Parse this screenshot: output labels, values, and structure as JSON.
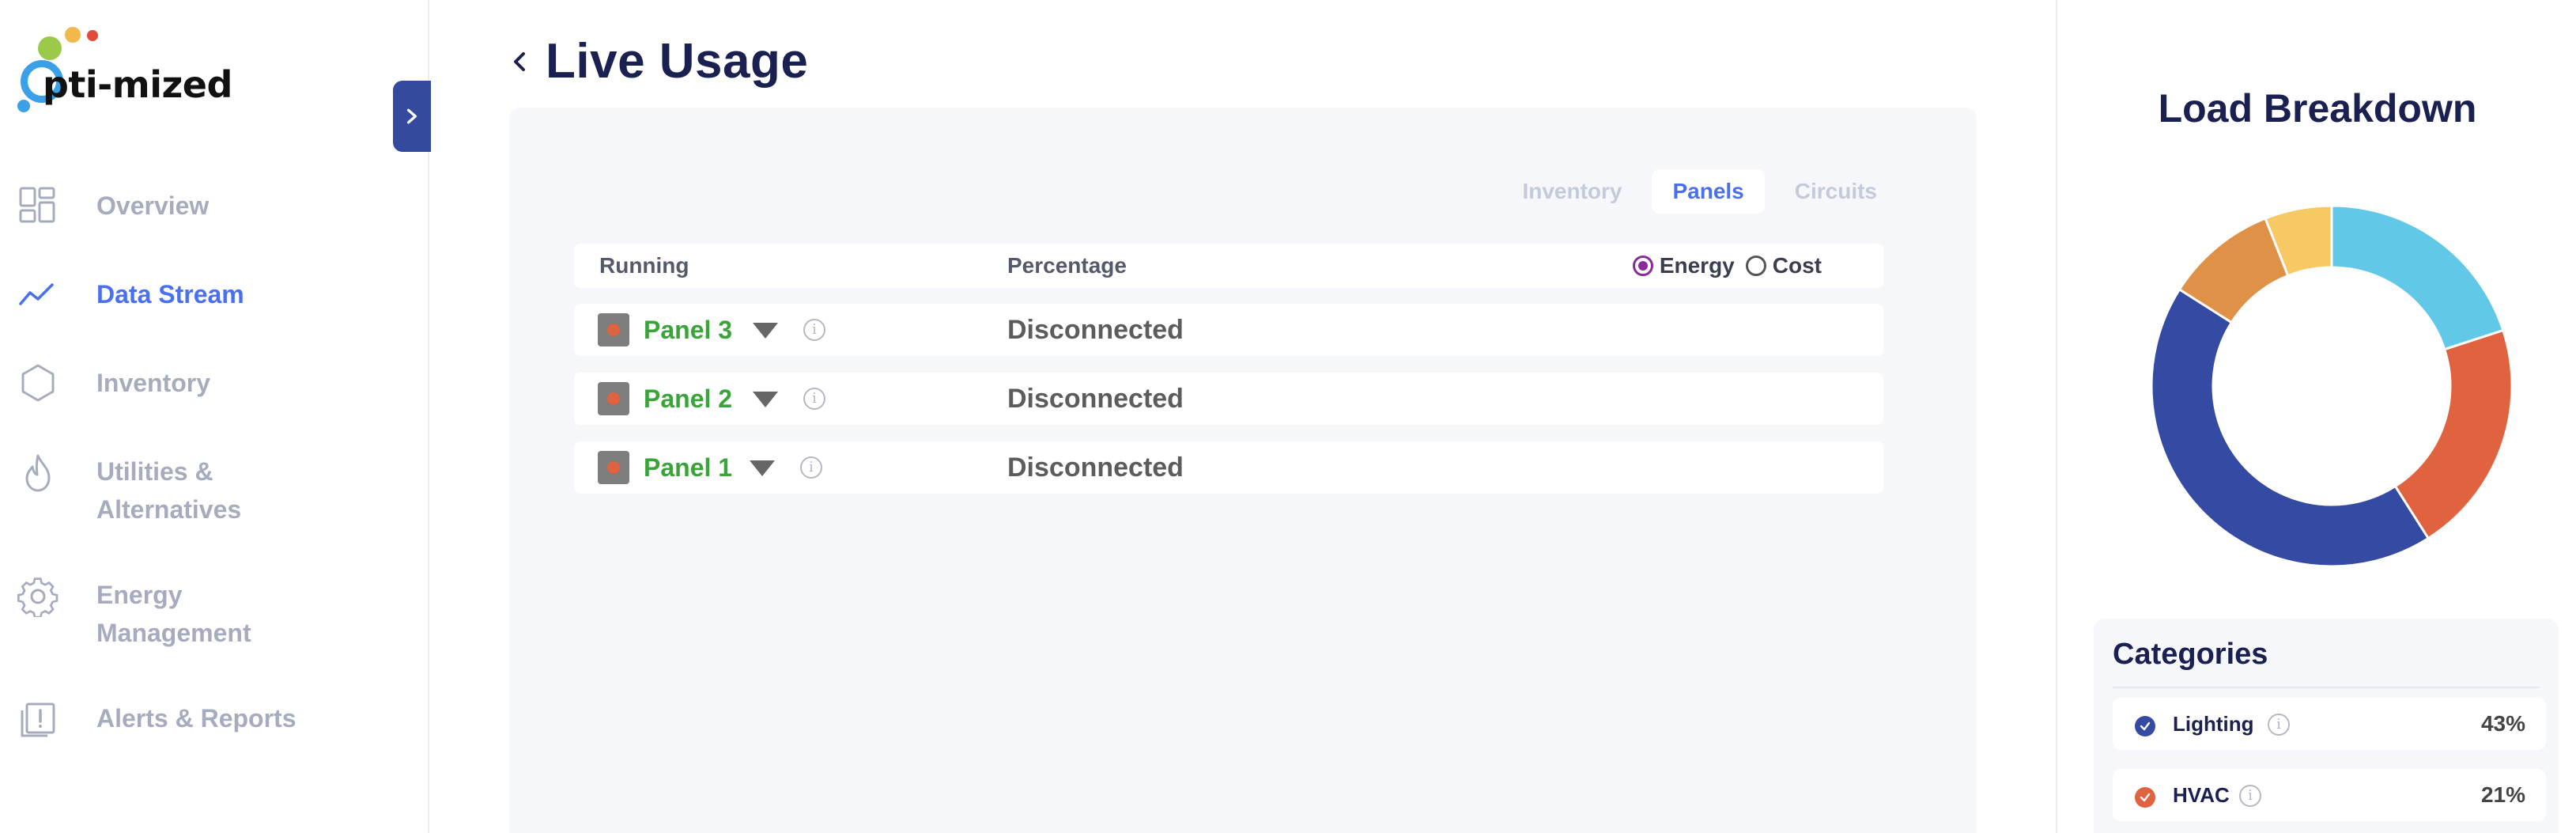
{
  "app": {
    "brand": "Opti-mized",
    "brand_text": "pti-mized",
    "brand_dot_colors": [
      "#9bc94a",
      "#f2b84b",
      "#e04b3a"
    ]
  },
  "sidebar": {
    "items": [
      {
        "label": "Overview",
        "icon": "grid-icon",
        "active": false
      },
      {
        "label": "Data Stream",
        "icon": "trend-line-icon",
        "active": true
      },
      {
        "label": "Inventory",
        "icon": "hexagon-icon",
        "active": false
      },
      {
        "label": "Utilities &",
        "label2": "Alternatives",
        "icon": "flame-icon",
        "active": false
      },
      {
        "label": "Energy",
        "label2": "Management",
        "icon": "gear-icon",
        "active": false
      },
      {
        "label": "Alerts & Reports",
        "icon": "alert-report-icon",
        "active": false
      }
    ]
  },
  "main": {
    "title": "Live Usage",
    "tabs": [
      {
        "label": "Inventory",
        "active": false
      },
      {
        "label": "Panels",
        "active": true
      },
      {
        "label": "Circuits",
        "active": false
      }
    ],
    "table": {
      "col_running": "Running",
      "col_percentage": "Percentage",
      "mode_energy": "Energy",
      "mode_cost": "Cost",
      "mode_selected": "Energy",
      "rows": [
        {
          "name": "Panel 3",
          "status": "Disconnected"
        },
        {
          "name": "Panel 2",
          "status": "Disconnected"
        },
        {
          "name": "Panel 1",
          "status": "Disconnected"
        }
      ]
    }
  },
  "right": {
    "title": "Load Breakdown",
    "categories_title": "Categories",
    "categories": [
      {
        "label": "Lighting",
        "pct": "43%",
        "color": "#354ba3"
      },
      {
        "label": "HVAC",
        "pct": "21%",
        "color": "#e0623f"
      }
    ],
    "donut": [
      {
        "name": "segment-skyblue",
        "value": 20,
        "color": "#62c8e8"
      },
      {
        "name": "segment-orange-red",
        "value": 21,
        "color": "#e0623f"
      },
      {
        "name": "segment-blue",
        "value": 43,
        "color": "#354ba3"
      },
      {
        "name": "segment-orange",
        "value": 10,
        "color": "#e09148"
      },
      {
        "name": "segment-yellow",
        "value": 6,
        "color": "#f6c964"
      }
    ]
  }
}
